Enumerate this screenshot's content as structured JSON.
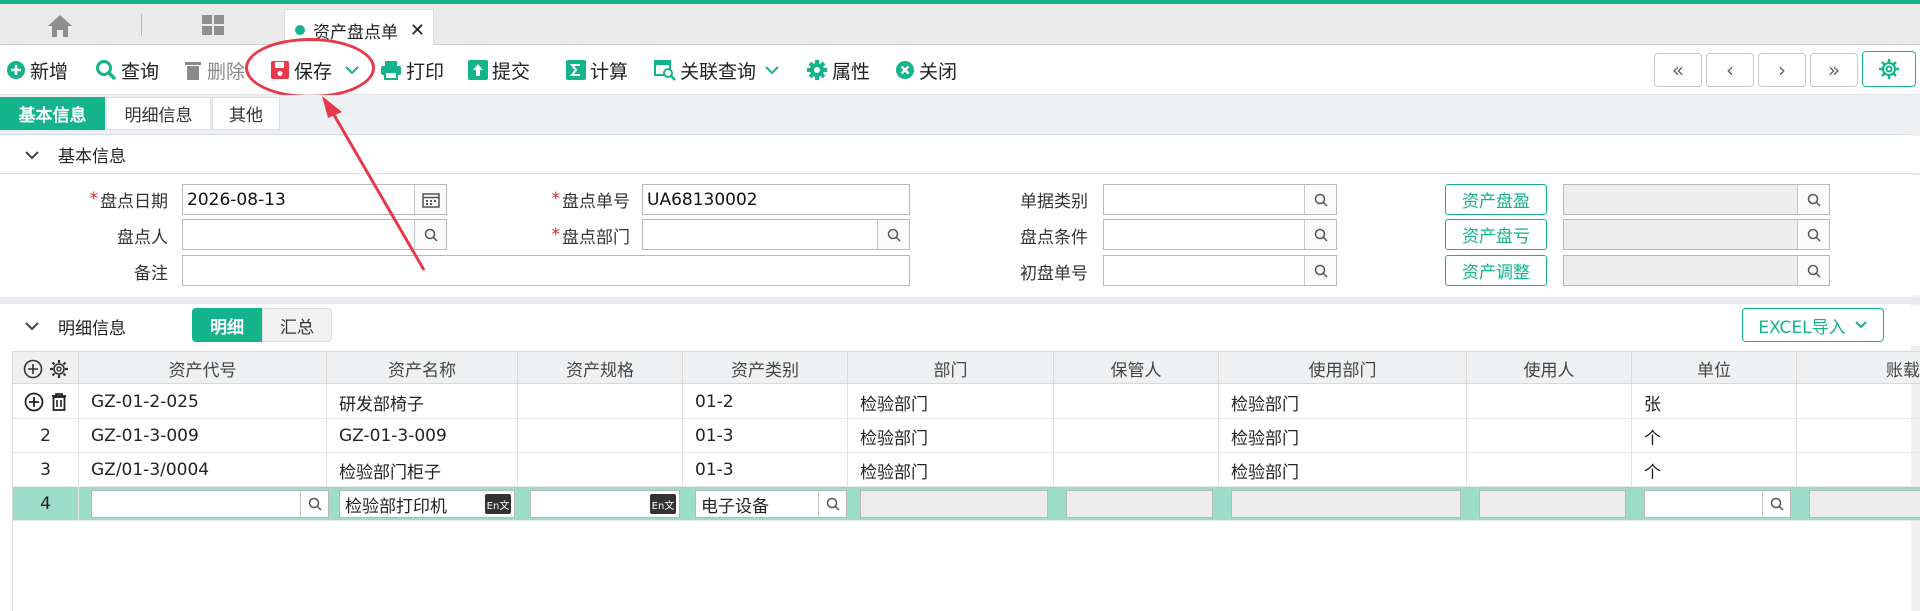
{
  "tabs": {
    "doc_title": "资产盘点单",
    "close": "✕"
  },
  "toolbar": {
    "new": "新增",
    "query": "查询",
    "delete": "删除",
    "save": "保存",
    "print": "打印",
    "submit": "提交",
    "calc": "计算",
    "related": "关联查询",
    "props": "属性",
    "close": "关闭"
  },
  "nav": {
    "first": "«",
    "prev": "‹",
    "next": "›",
    "last": "»"
  },
  "subtabs": [
    "基本信息",
    "明细信息",
    "其他"
  ],
  "basic": {
    "section_title": "基本信息",
    "date_label": "盘点日期",
    "date_value": "2026-08-13",
    "no_label": "盘点单号",
    "no_value": "UA68130002",
    "type_label": "单据类别",
    "type_value": "",
    "person_label": "盘点人",
    "person_value": "",
    "dept_label": "盘点部门",
    "dept_value": "",
    "cond_label": "盘点条件",
    "cond_value": "",
    "remark_label": "备注",
    "remark_value": "",
    "first_label": "初盘单号",
    "first_value": "",
    "gain_btn": "资产盘盈",
    "loss_btn": "资产盘亏",
    "adjust_btn": "资产调整",
    "required_mark": "*"
  },
  "detail": {
    "section_title": "明细信息",
    "tab_detail": "明细",
    "tab_summary": "汇总",
    "excel": "EXCEL导入",
    "columns": [
      "资产代号",
      "资产名称",
      "资产规格",
      "资产类别",
      "部门",
      "保管人",
      "使用部门",
      "使用人",
      "单位",
      "账载"
    ],
    "rows": [
      {
        "idx": "",
        "code": "GZ-01-2-025",
        "name": "研发部椅子",
        "spec": "",
        "cat": "01-2",
        "dept": "检验部门",
        "keeper": "",
        "use_dept": "检验部门",
        "user": "",
        "unit": "张"
      },
      {
        "idx": "2",
        "code": "GZ-01-3-009",
        "name": "GZ-01-3-009",
        "spec": "",
        "cat": "01-3",
        "dept": "检验部门",
        "keeper": "",
        "use_dept": "检验部门",
        "user": "",
        "unit": "个"
      },
      {
        "idx": "3",
        "code": "GZ/01-3/0004",
        "name": "检验部门柜子",
        "spec": "",
        "cat": "01-3",
        "dept": "检验部门",
        "keeper": "",
        "use_dept": "检验部门",
        "user": "",
        "unit": "个"
      }
    ],
    "edit_row": {
      "idx": "4",
      "code": "",
      "name": "检验部打印机",
      "spec": "",
      "cat": "电子设备",
      "unit": ""
    },
    "en_badge": "En文"
  },
  "colors": {
    "accent": "#13b38b",
    "highlight": "#e8394a",
    "selected_row": "#9ddcc8"
  }
}
